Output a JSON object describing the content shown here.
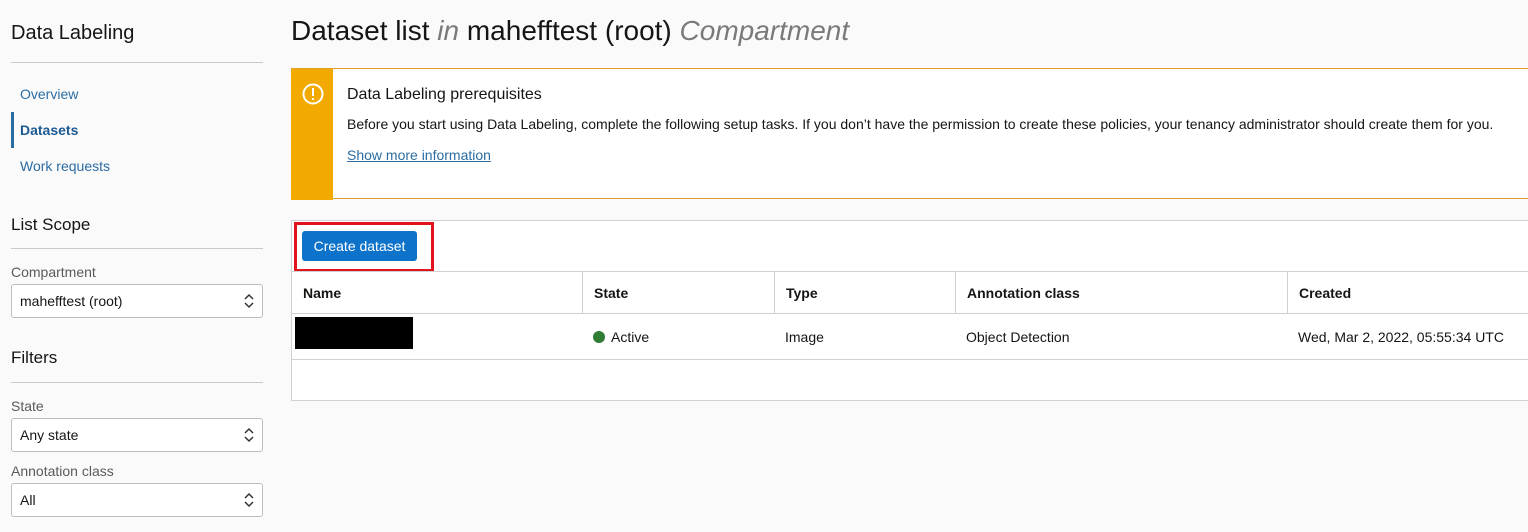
{
  "sidebar": {
    "title": "Data Labeling",
    "nav": [
      {
        "label": "Overview"
      },
      {
        "label": "Datasets"
      },
      {
        "label": "Work requests"
      }
    ],
    "list_scope": {
      "title": "List Scope",
      "compartment_label": "Compartment",
      "compartment_value": "mahefftest (root)"
    },
    "filters": {
      "title": "Filters",
      "state_label": "State",
      "state_value": "Any state",
      "annotation_label": "Annotation class",
      "annotation_value": "All"
    }
  },
  "header": {
    "title_main": "Dataset list",
    "title_in": "in",
    "title_compartment": "mahefftest (root)",
    "title_suffix": "Compartment"
  },
  "alert": {
    "title": "Data Labeling prerequisites",
    "text": "Before you start using Data Labeling, complete the following setup tasks. If you don’t have the permission to create these policies, your tenancy administrator should create them for you.",
    "link": "Show more information"
  },
  "toolbar": {
    "create_label": "Create dataset"
  },
  "table": {
    "columns": [
      "Name",
      "State",
      "Type",
      "Annotation class",
      "Created"
    ],
    "rows": [
      {
        "name": "",
        "state": "Active",
        "type": "Image",
        "annotation_class": "Object Detection",
        "created": "Wed, Mar 2, 2022, 05:55:34 UTC"
      }
    ]
  },
  "colors": {
    "accent": "#0d72c9",
    "warning": "#f2a900",
    "active": "#2f7d32",
    "highlight": "#e1141e"
  }
}
